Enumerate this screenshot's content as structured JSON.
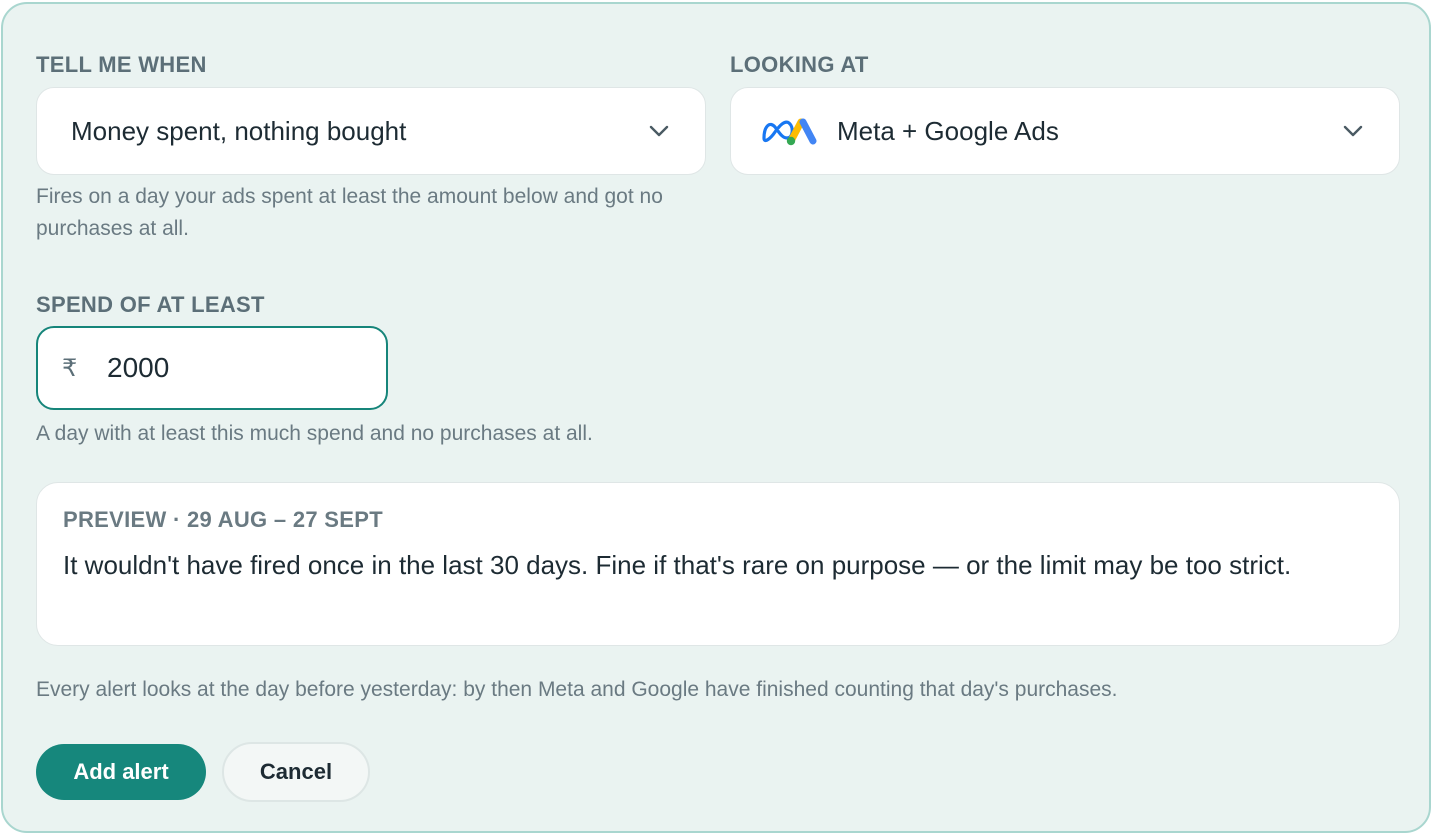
{
  "trigger": {
    "label": "TELL ME WHEN",
    "selected": "Money spent, nothing bought",
    "hint": "Fires on a day your ads spent at least the amount below and got no purchases at all."
  },
  "source": {
    "label": "LOOKING AT",
    "selected": "Meta + Google Ads",
    "icons": [
      "meta-logo",
      "google-ads-logo"
    ]
  },
  "spend": {
    "label": "SPEND OF AT LEAST",
    "currency": "₹",
    "value": "2000",
    "hint": "A day with at least this much spend and no purchases at all."
  },
  "preview": {
    "heading": "PREVIEW · 29 AUG – 27 SEPT",
    "body": "It wouldn't have fired once in the last 30 days. Fine if that's rare on purpose — or the limit may be too strict."
  },
  "footer_note": "Every alert looks at the day before yesterday: by then Meta and Google have finished counting that day's purchases.",
  "actions": {
    "add_label": "Add alert",
    "cancel_label": "Cancel"
  },
  "colors": {
    "accent": "#16877c",
    "panel_bg": "#eaf3f1",
    "panel_border": "#a9d6cf"
  }
}
